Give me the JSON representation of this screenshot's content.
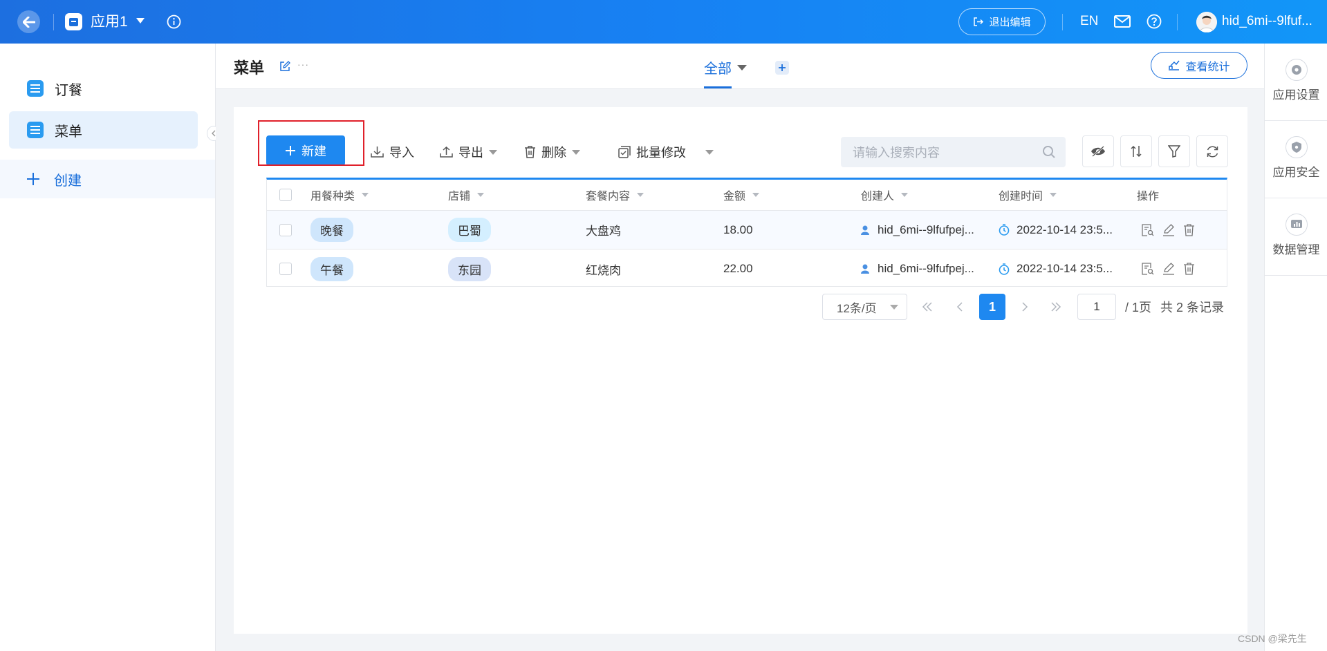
{
  "topbar": {
    "app_name": "应用1",
    "exit_edit_label": "退出编辑",
    "lang": "EN",
    "username": "hid_6mi--9lfuf..."
  },
  "sidebar": {
    "items": [
      {
        "label": "订餐",
        "active": false
      },
      {
        "label": "菜单",
        "active": true
      }
    ],
    "create_label": "创建"
  },
  "rightrail": {
    "items": [
      {
        "label": "应用设置",
        "icon": "gear-icon"
      },
      {
        "label": "应用安全",
        "icon": "shield-icon"
      },
      {
        "label": "数据管理",
        "icon": "data-icon"
      }
    ]
  },
  "page": {
    "title": "菜单",
    "more": "···",
    "view_tab": "全部",
    "stats_label": "查看统计"
  },
  "toolbar": {
    "new_label": "新建",
    "import_label": "导入",
    "export_label": "导出",
    "delete_label": "删除",
    "batch_edit_label": "批量修改",
    "search_placeholder": "请输入搜索内容"
  },
  "table": {
    "columns": [
      "用餐种类",
      "店铺",
      "套餐内容",
      "金额",
      "创建人",
      "创建时间",
      "操作"
    ],
    "rows": [
      {
        "meal_type": "晚餐",
        "shop": "巴蜀",
        "content": "大盘鸡",
        "amount": "18.00",
        "creator": "hid_6mi--9lfufpej...",
        "created_at": "2022-10-14 23:5..."
      },
      {
        "meal_type": "午餐",
        "shop": "东园",
        "content": "红烧肉",
        "amount": "22.00",
        "creator": "hid_6mi--9lfufpej...",
        "created_at": "2022-10-14 23:5..."
      }
    ]
  },
  "pagination": {
    "page_size": "12条/页",
    "current_page": "1",
    "jump_value": "1",
    "total_pages": "/ 1页",
    "total_records": "共 2 条记录"
  },
  "watermark": "CSDN @梁先生",
  "colors": {
    "brand": "#1e88f0",
    "highlight_box": "#e0202a"
  }
}
